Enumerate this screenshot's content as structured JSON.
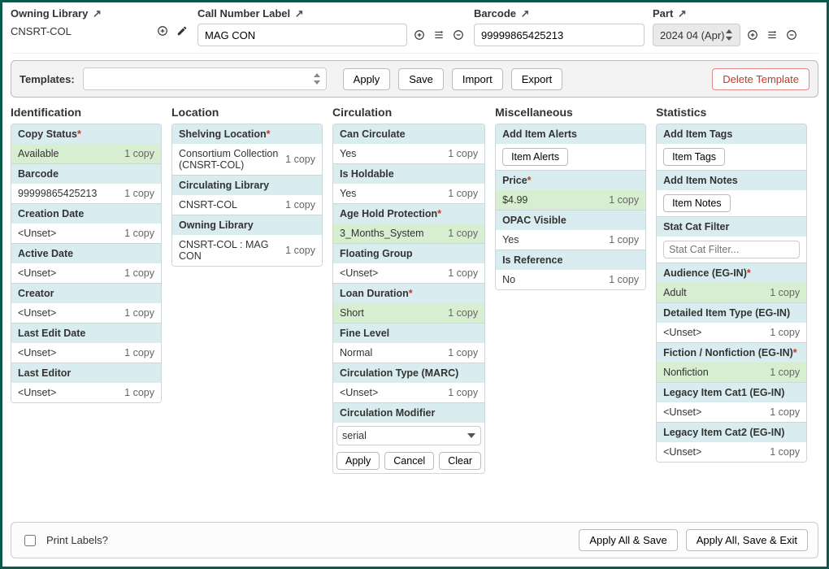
{
  "top": {
    "owning_library": {
      "label": "Owning Library",
      "value": "CNSRT-COL"
    },
    "call_number": {
      "label": "Call Number Label",
      "value": "MAG CON"
    },
    "barcode": {
      "label": "Barcode",
      "value": "99999865425213"
    },
    "part": {
      "label": "Part",
      "value": "2024 04 (Apr)"
    }
  },
  "templates": {
    "label": "Templates:",
    "apply": "Apply",
    "save": "Save",
    "import": "Import",
    "export": "Export",
    "delete": "Delete Template"
  },
  "sections": {
    "identification": "Identification",
    "location": "Location",
    "circulation": "Circulation",
    "miscellaneous": "Miscellaneous",
    "statistics": "Statistics"
  },
  "ident": {
    "copy_status": {
      "label": "Copy Status",
      "value": "Available",
      "count": "1 copy"
    },
    "barcode": {
      "label": "Barcode",
      "value": "99999865425213",
      "count": "1 copy"
    },
    "creation_date": {
      "label": "Creation Date",
      "value": "<Unset>",
      "count": "1 copy"
    },
    "active_date": {
      "label": "Active Date",
      "value": "<Unset>",
      "count": "1 copy"
    },
    "creator": {
      "label": "Creator",
      "value": "<Unset>",
      "count": "1 copy"
    },
    "last_edit_date": {
      "label": "Last Edit Date",
      "value": "<Unset>",
      "count": "1 copy"
    },
    "last_editor": {
      "label": "Last Editor",
      "value": "<Unset>",
      "count": "1 copy"
    }
  },
  "loc": {
    "shelving": {
      "label": "Shelving Location",
      "value": "Consortium Collection (CNSRT-COL)",
      "count": "1 copy"
    },
    "circ_lib": {
      "label": "Circulating Library",
      "value": "CNSRT-COL",
      "count": "1 copy"
    },
    "own_lib": {
      "label": "Owning Library",
      "value": "CNSRT-COL : MAG CON",
      "count": "1 copy"
    }
  },
  "circ": {
    "can_circ": {
      "label": "Can Circulate",
      "value": "Yes",
      "count": "1 copy"
    },
    "holdable": {
      "label": "Is Holdable",
      "value": "Yes",
      "count": "1 copy"
    },
    "age_hold": {
      "label": "Age Hold Protection",
      "value": "3_Months_System",
      "count": "1 copy"
    },
    "floating": {
      "label": "Floating Group",
      "value": "<Unset>",
      "count": "1 copy"
    },
    "loan_dur": {
      "label": "Loan Duration",
      "value": "Short",
      "count": "1 copy"
    },
    "fine_level": {
      "label": "Fine Level",
      "value": "Normal",
      "count": "1 copy"
    },
    "circ_type": {
      "label": "Circulation Type (MARC)",
      "value": "<Unset>",
      "count": "1 copy"
    },
    "circ_mod": {
      "label": "Circulation Modifier",
      "value": "serial",
      "apply": "Apply",
      "cancel": "Cancel",
      "clear": "Clear"
    }
  },
  "misc": {
    "alerts": {
      "label": "Add Item Alerts",
      "button": "Item Alerts"
    },
    "price": {
      "label": "Price",
      "value": "$4.99",
      "count": "1 copy"
    },
    "opac": {
      "label": "OPAC Visible",
      "value": "Yes",
      "count": "1 copy"
    },
    "ref": {
      "label": "Is Reference",
      "value": "No",
      "count": "1 copy"
    }
  },
  "stats": {
    "tags": {
      "label": "Add Item Tags",
      "button": "Item Tags"
    },
    "notes": {
      "label": "Add Item Notes",
      "button": "Item Notes"
    },
    "filter": {
      "label": "Stat Cat Filter",
      "placeholder": "Stat Cat Filter..."
    },
    "audience": {
      "label": "Audience (EG-IN)",
      "value": "Adult",
      "count": "1 copy"
    },
    "detailed": {
      "label": "Detailed Item Type (EG-IN)",
      "value": "<Unset>",
      "count": "1 copy"
    },
    "fiction": {
      "label": "Fiction / Nonfiction (EG-IN)",
      "value": "Nonfiction",
      "count": "1 copy"
    },
    "legacy1": {
      "label": "Legacy Item Cat1 (EG-IN)",
      "value": "<Unset>",
      "count": "1 copy"
    },
    "legacy2": {
      "label": "Legacy Item Cat2 (EG-IN)",
      "value": "<Unset>",
      "count": "1 copy"
    }
  },
  "bottom": {
    "print_labels": "Print Labels?",
    "apply_save": "Apply All & Save",
    "apply_save_exit": "Apply All, Save & Exit"
  }
}
